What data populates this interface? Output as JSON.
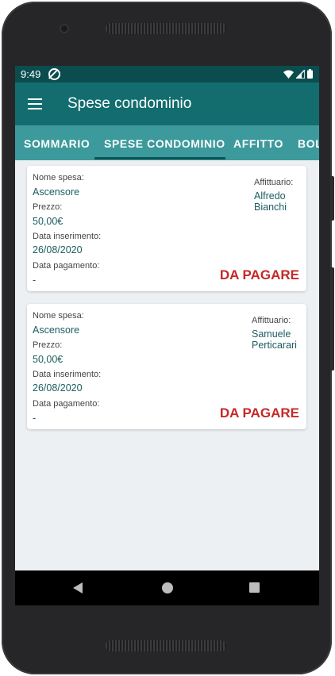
{
  "status_bar": {
    "time": "9:49"
  },
  "app_bar": {
    "title": "Spese condominio"
  },
  "tabs": [
    {
      "label": "SOMMARIO"
    },
    {
      "label": "SPESE CONDOMINIO"
    },
    {
      "label": "AFFITTO"
    },
    {
      "label": "BOL"
    }
  ],
  "labels": {
    "expense_name": "Nome spesa:",
    "price": "Prezzo:",
    "insert_date": "Data inserimento:",
    "payment_date": "Data pagamento:",
    "tenant": "Affittuario:"
  },
  "expenses": [
    {
      "name": "Ascensore",
      "price": "50,00€",
      "insert_date": "26/08/2020",
      "payment_date": "-",
      "tenant_first": "Alfredo",
      "tenant_last": "Bianchi",
      "status": "DA PAGARE"
    },
    {
      "name": "Ascensore",
      "price": "50,00€",
      "insert_date": "26/08/2020",
      "payment_date": "-",
      "tenant_first": "Samuele",
      "tenant_last": "Perticarari",
      "status": "DA PAGARE"
    }
  ],
  "colors": {
    "status_bar": "#0b4d4f",
    "app_bar": "#136d6e",
    "tab_bar": "#3d9a9c",
    "value_text": "#1b5d62",
    "unpaid_status": "#c62828"
  }
}
